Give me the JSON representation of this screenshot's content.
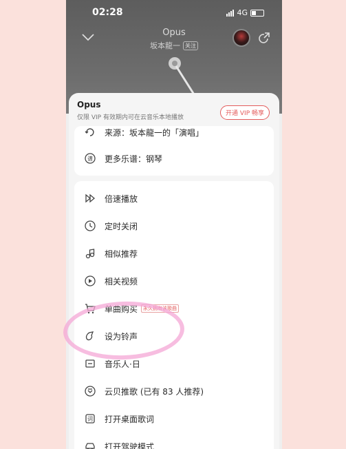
{
  "status_bar": {
    "time": "02:28",
    "network": "4G"
  },
  "player": {
    "title": "Opus",
    "artist": "坂本龍一",
    "follow_label": "关注"
  },
  "sheet": {
    "title": "Opus",
    "subtitle": "仅限 VIP 有效期内可在云音乐本地播放",
    "vip_button": "开通 VIP 畅享",
    "top_items": [
      {
        "icon": "source-icon",
        "label": "来源：坂本龍一的「演唱」"
      },
      {
        "icon": "score-icon",
        "label": "更多乐谱：钢琴"
      }
    ],
    "items": [
      {
        "icon": "speed-icon",
        "label": "倍速播放",
        "tag": ""
      },
      {
        "icon": "timer-icon",
        "label": "定时关闭",
        "tag": ""
      },
      {
        "icon": "similar-icon",
        "label": "相似推荐",
        "tag": ""
      },
      {
        "icon": "video-icon",
        "label": "相关视频",
        "tag": ""
      },
      {
        "icon": "cart-icon",
        "label": "单曲购买",
        "tag": "永久拥有该歌曲"
      },
      {
        "icon": "ringtone-icon",
        "label": "设为铃声",
        "tag": ""
      },
      {
        "icon": "musician-icon",
        "label": "音乐人·日",
        "tag": ""
      },
      {
        "icon": "recommend-icon",
        "label": "云贝推歌 (已有 83 人推荐)",
        "tag": ""
      },
      {
        "icon": "lyrics-icon",
        "label": "打开桌面歌词",
        "tag": ""
      },
      {
        "icon": "car-icon",
        "label": "打开驾驶模式",
        "tag": ""
      }
    ]
  },
  "colors": {
    "accent": "#e35b5b",
    "highlight": "#f4a7d6",
    "background": "#fbe1dc"
  }
}
